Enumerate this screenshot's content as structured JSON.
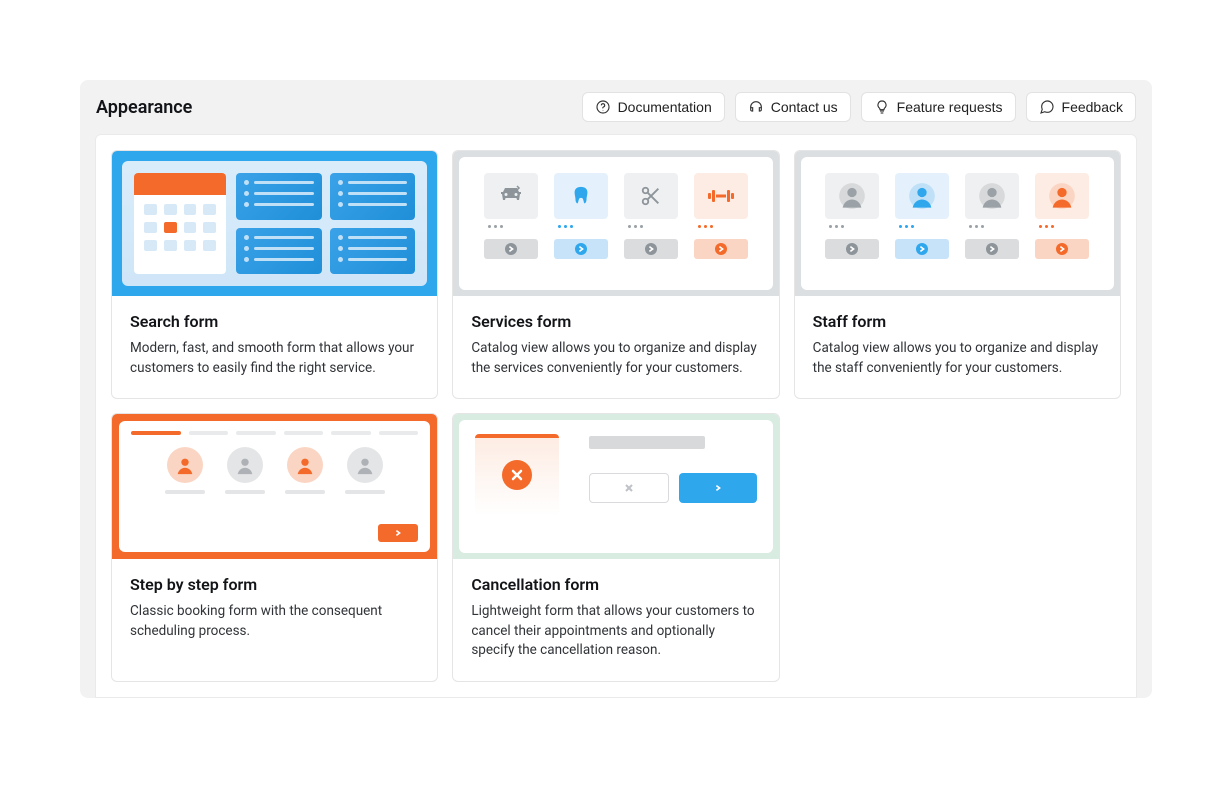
{
  "header": {
    "title": "Appearance",
    "buttons": {
      "docs": "Documentation",
      "contact": "Contact us",
      "feature": "Feature requests",
      "feedback": "Feedback"
    }
  },
  "cards": {
    "search": {
      "title": "Search form",
      "desc": "Modern, fast, and smooth form that allows your customers to easily find the right service."
    },
    "services": {
      "title": "Services form",
      "desc": "Catalog view allows you to organize and display the services conveniently for your customers."
    },
    "staff": {
      "title": "Staff form",
      "desc": "Catalog view allows you to organize and display the staff conveniently for your customers."
    },
    "step": {
      "title": "Step by step form",
      "desc": "Classic booking form with the consequent scheduling process."
    },
    "cancel": {
      "title": "Cancellation form",
      "desc": "Lightweight form that allows your customers to cancel their appointments and optionally specify the cancellation reason."
    }
  },
  "colors": {
    "blue": "#2ea7ed",
    "orange": "#f46a2a",
    "gray": "#8d949a",
    "mint": "#d9ece1"
  }
}
